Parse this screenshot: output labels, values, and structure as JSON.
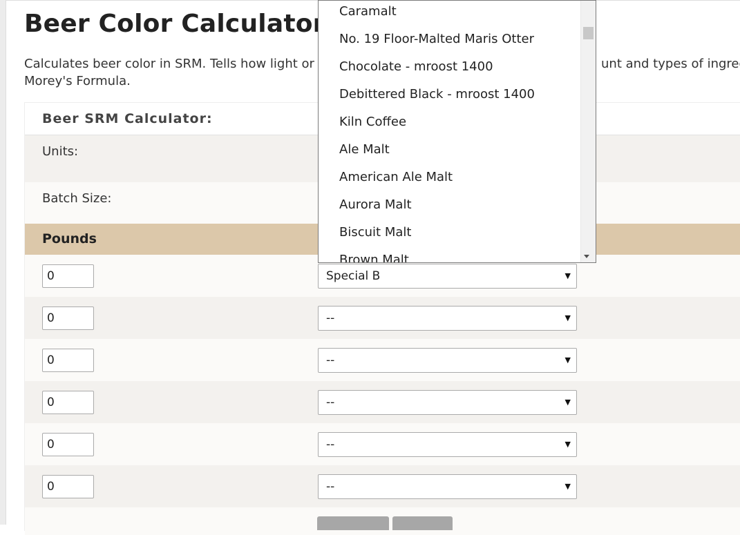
{
  "page": {
    "title": "Beer Color Calculator SR",
    "intro_left": "Calculates beer color in SRM. Tells how light or da",
    "intro_right": "unt and types of ingredie",
    "intro_line2": "Morey's Formula."
  },
  "calculator": {
    "header": "Beer SRM Calculator:",
    "units_label": "Units:",
    "batch_label": "Batch Size:",
    "column_pounds": "Pounds"
  },
  "grains": [
    {
      "pounds": "0",
      "selected": "Special B"
    },
    {
      "pounds": "0",
      "selected": "--"
    },
    {
      "pounds": "0",
      "selected": "--"
    },
    {
      "pounds": "0",
      "selected": "--"
    },
    {
      "pounds": "0",
      "selected": "--"
    },
    {
      "pounds": "0",
      "selected": "--"
    }
  ],
  "select_arrow": "▼",
  "dropdown": {
    "options": [
      "Caramalt",
      "No. 19 Floor-Malted Maris Otter",
      "Chocolate - mroost 1400",
      "Debittered Black - mroost 1400",
      "Kiln Coffee",
      "Ale Malt",
      "American Ale Malt",
      "Aurora Malt",
      "Biscuit Malt",
      "Brown Malt"
    ]
  }
}
